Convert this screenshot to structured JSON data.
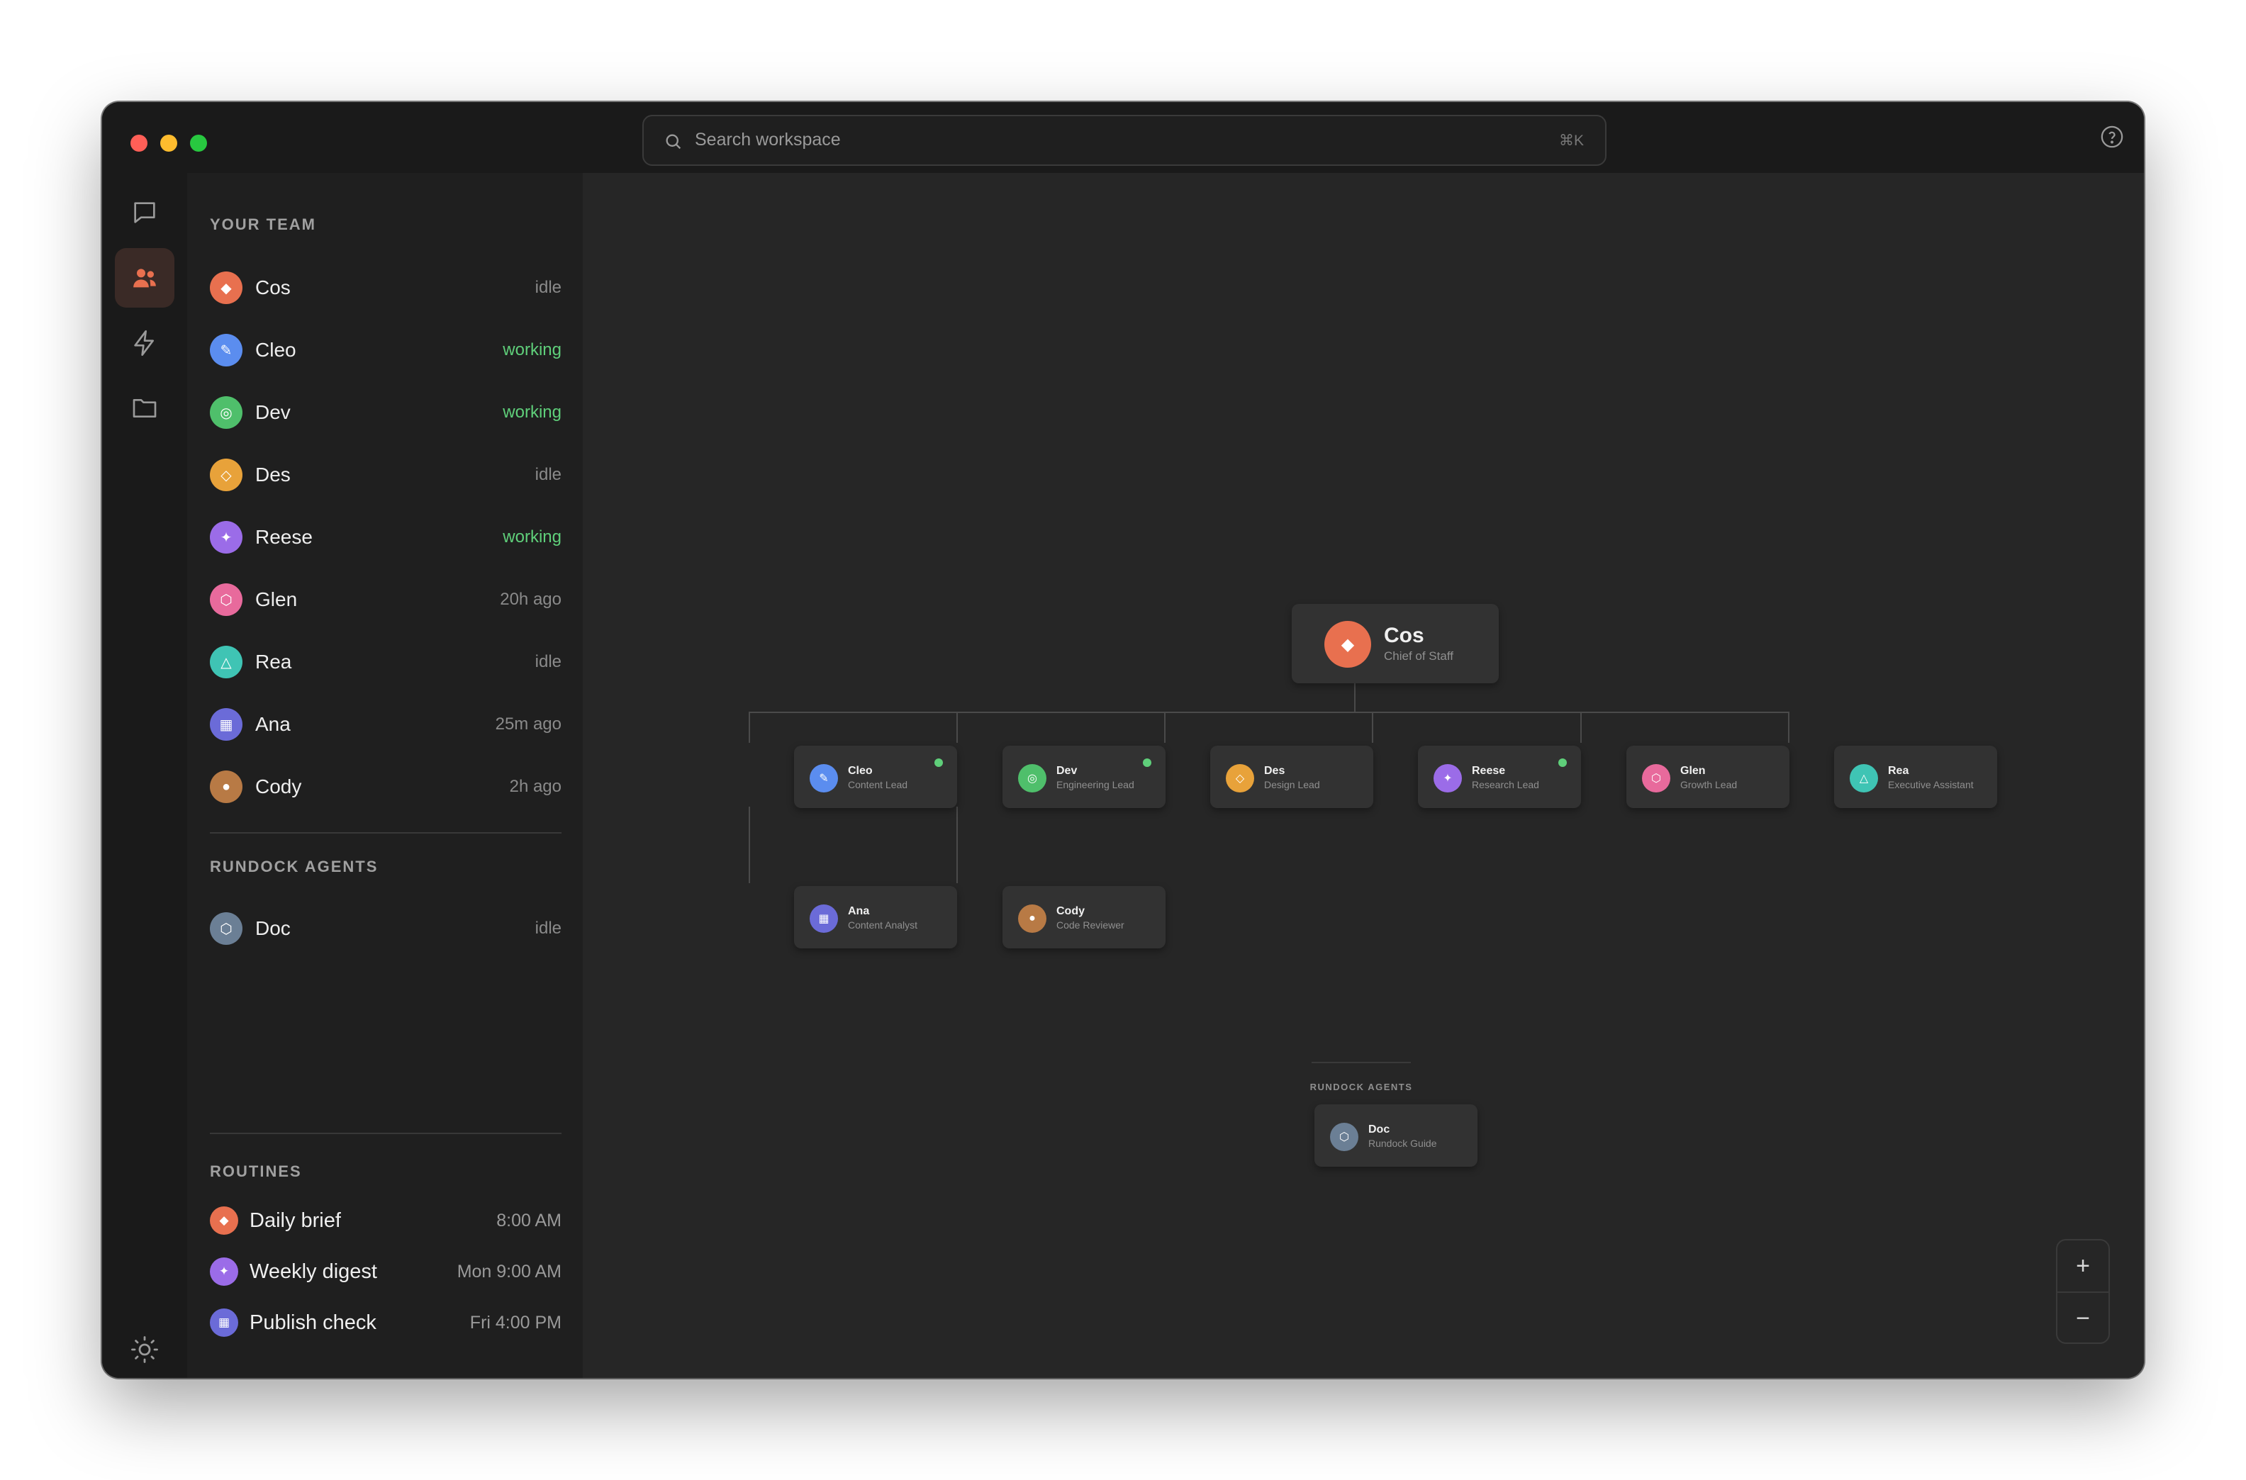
{
  "search": {
    "placeholder": "Search workspace",
    "shortcut": "⌘K"
  },
  "sidebar": {
    "team_title": "YOUR TEAM",
    "team": [
      {
        "name": "Cos",
        "status": "idle",
        "color": "#e8704f",
        "glyph": "◆"
      },
      {
        "name": "Cleo",
        "status": "working",
        "color": "#5b8def",
        "glyph": "✎"
      },
      {
        "name": "Dev",
        "status": "working",
        "color": "#4fbf6b",
        "glyph": "◎"
      },
      {
        "name": "Des",
        "status": "idle",
        "color": "#e8a23a",
        "glyph": "◇"
      },
      {
        "name": "Reese",
        "status": "working",
        "color": "#9b6ce8",
        "glyph": "✦"
      },
      {
        "name": "Glen",
        "status": "20h ago",
        "color": "#e86a9c",
        "glyph": "⬡"
      },
      {
        "name": "Rea",
        "status": "idle",
        "color": "#3fc4b4",
        "glyph": "△"
      },
      {
        "name": "Ana",
        "status": "25m ago",
        "color": "#6b6bd8",
        "glyph": "▦"
      },
      {
        "name": "Cody",
        "status": "2h ago",
        "color": "#b87a45",
        "glyph": "●"
      }
    ],
    "agents_title": "RUNDOCK AGENTS",
    "agents": [
      {
        "name": "Doc",
        "status": "idle",
        "color": "#6b7f95",
        "glyph": "⬡"
      }
    ],
    "routines_title": "ROUTINES",
    "routines": [
      {
        "name": "Daily brief",
        "time": "8:00 AM",
        "color": "#e8704f",
        "glyph": "◆"
      },
      {
        "name": "Weekly digest",
        "time": "Mon 9:00 AM",
        "color": "#9b6ce8",
        "glyph": "✦"
      },
      {
        "name": "Publish check",
        "time": "Fri 4:00 PM",
        "color": "#6b6bd8",
        "glyph": "▦"
      }
    ]
  },
  "org": {
    "root": {
      "name": "Cos",
      "role": "Chief of Staff"
    },
    "leads": [
      {
        "name": "Cleo",
        "role": "Content Lead",
        "active": true
      },
      {
        "name": "Dev",
        "role": "Engineering Lead",
        "active": true
      },
      {
        "name": "Des",
        "role": "Design Lead",
        "active": false
      },
      {
        "name": "Reese",
        "role": "Research Lead",
        "active": true
      },
      {
        "name": "Glen",
        "role": "Growth Lead",
        "active": false
      },
      {
        "name": "Rea",
        "role": "Executive Assistant",
        "active": false
      }
    ],
    "reports": [
      {
        "name": "Ana",
        "role": "Content Analyst"
      },
      {
        "name": "Cody",
        "role": "Code Reviewer"
      }
    ],
    "agents_label": "RUNDOCK AGENTS",
    "agent": {
      "name": "Doc",
      "role": "Rundock Guide"
    }
  },
  "zoom": {
    "in": "+",
    "out": "−"
  }
}
